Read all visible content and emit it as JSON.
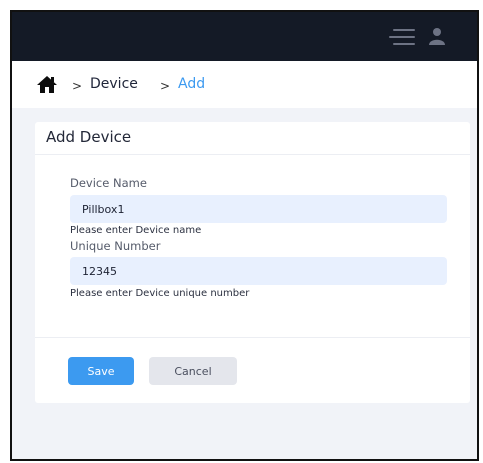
{
  "navbar": {
    "menu_icon": "menu-icon",
    "user_icon": "user-icon"
  },
  "breadcrumb": {
    "home_icon": "home-icon",
    "separator": ">",
    "device": "Device",
    "current": "Add"
  },
  "card": {
    "title": "Add Device",
    "fields": [
      {
        "label": "Device Name",
        "value": "Pillbox1",
        "help": "Please enter Device name"
      },
      {
        "label": "Unique Number",
        "value": "12345",
        "help": "Please enter Device unique number"
      }
    ],
    "save_label": "Save",
    "cancel_label": "Cancel"
  },
  "colors": {
    "navbar_bg": "#141a26",
    "accent": "#3c9af0",
    "input_bg": "#e8f0fe",
    "page_bg": "#f1f3f8"
  }
}
